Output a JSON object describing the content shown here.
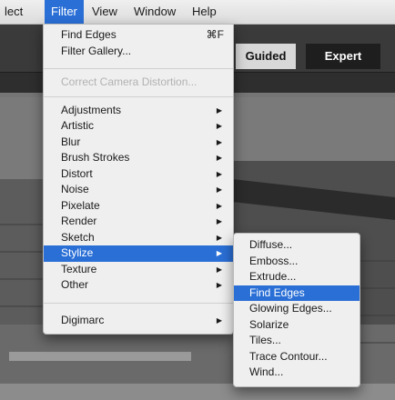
{
  "menubar": [
    "lect",
    "Filter",
    "View",
    "Window",
    "Help"
  ],
  "modes": {
    "guided": "Guided",
    "expert": "Expert"
  },
  "filter_menu": {
    "find_edges": "Find Edges",
    "find_edges_shortcut": "⌘F",
    "filter_gallery": "Filter Gallery...",
    "correct_camera": "Correct Camera Distortion...",
    "categories": [
      "Adjustments",
      "Artistic",
      "Blur",
      "Brush Strokes",
      "Distort",
      "Noise",
      "Pixelate",
      "Render",
      "Sketch",
      "Stylize",
      "Texture",
      "Other"
    ],
    "digimarc": "Digimarc"
  },
  "stylize_submenu": [
    "Diffuse...",
    "Emboss...",
    "Extrude...",
    "Find Edges",
    "Glowing Edges...",
    "Solarize",
    "Tiles...",
    "Trace Contour...",
    "Wind..."
  ],
  "colors": {
    "highlight": "#2a6fd6",
    "menu_bg": "#efefef"
  }
}
